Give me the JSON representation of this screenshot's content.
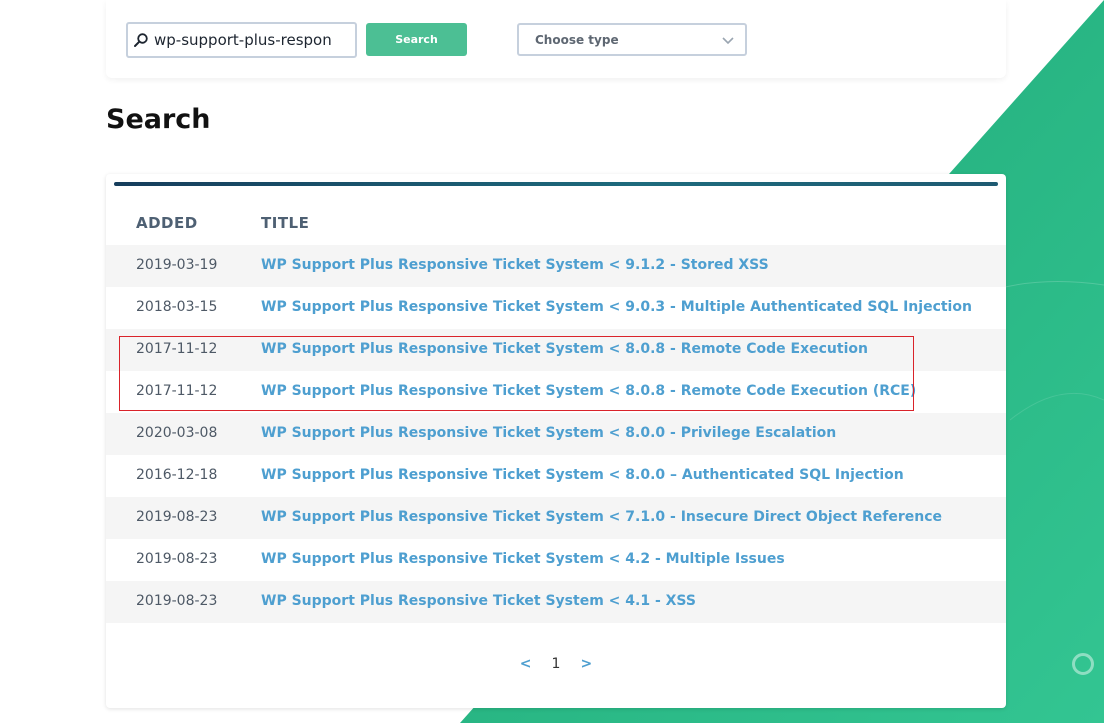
{
  "search": {
    "value": "wp-support-plus-respon",
    "button_label": "Search"
  },
  "type_select": {
    "selected": "Choose type"
  },
  "page_title": "Search",
  "table": {
    "headers": {
      "added": "ADDED",
      "title": "TITLE"
    },
    "rows": [
      {
        "date": "2019-03-19",
        "title": "WP Support Plus Responsive Ticket System < 9.1.2 - Stored XSS"
      },
      {
        "date": "2018-03-15",
        "title": "WP Support Plus Responsive Ticket System < 9.0.3 - Multiple Authenticated SQL Injection"
      },
      {
        "date": "2017-11-12",
        "title": "WP Support Plus Responsive Ticket System < 8.0.8 - Remote Code Execution"
      },
      {
        "date": "2017-11-12",
        "title": "WP Support Plus Responsive Ticket System < 8.0.8 - Remote Code Execution (RCE)"
      },
      {
        "date": "2020-03-08",
        "title": "WP Support Plus Responsive Ticket System < 8.0.0 - Privilege Escalation"
      },
      {
        "date": "2016-12-18",
        "title": "WP Support Plus Responsive Ticket System < 8.0.0 – Authenticated SQL Injection"
      },
      {
        "date": "2019-08-23",
        "title": "WP Support Plus Responsive Ticket System < 7.1.0 - Insecure Direct Object Reference"
      },
      {
        "date": "2019-08-23",
        "title": "WP Support Plus Responsive Ticket System < 4.2 - Multiple Issues"
      },
      {
        "date": "2019-08-23",
        "title": "WP Support Plus Responsive Ticket System < 4.1 - XSS"
      }
    ]
  },
  "pagination": {
    "prev": "<",
    "current": "1",
    "next": ">"
  },
  "colors": {
    "accent_green": "#4cbf94",
    "link_blue": "#4e9fd0",
    "highlight_red": "#d9232a",
    "bg_green": "#27b483"
  },
  "icons": {
    "search": "search-icon",
    "dropdown": "chevron-down-icon"
  }
}
